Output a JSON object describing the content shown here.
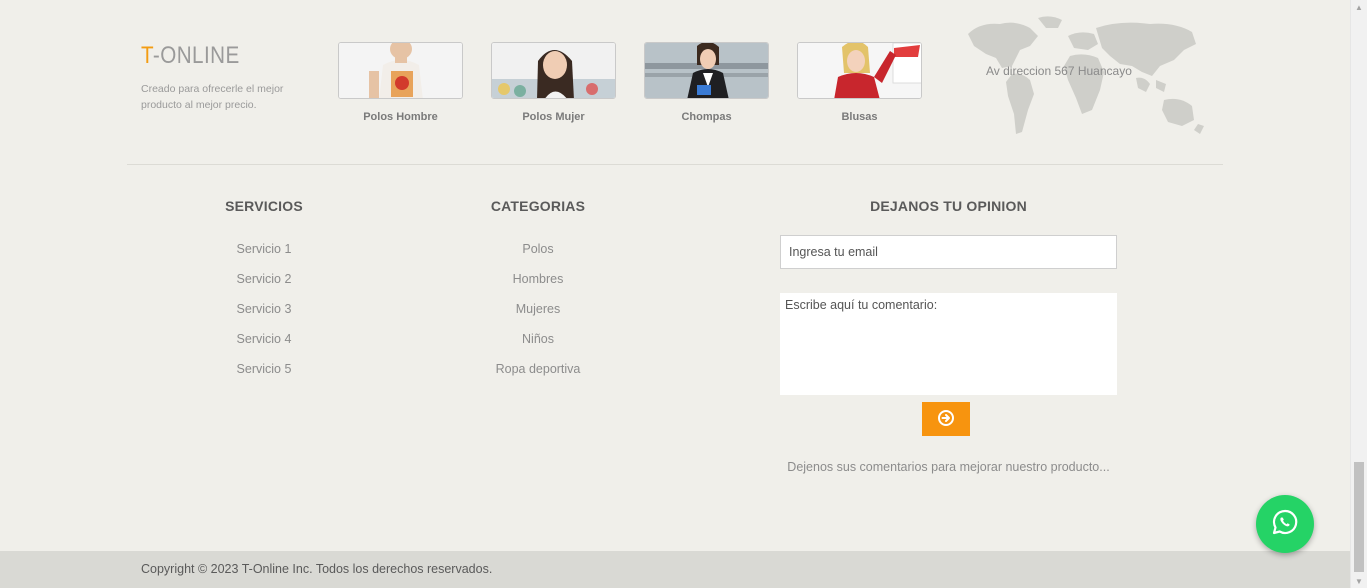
{
  "brand": {
    "title_accent": "T",
    "title_rest": "-ONLINE",
    "description": "Creado para ofrecerle el mejor producto al mejor precio."
  },
  "gallery": [
    {
      "caption": "Polos Hombre"
    },
    {
      "caption": "Polos Mujer"
    },
    {
      "caption": "Chompas"
    },
    {
      "caption": "Blusas"
    }
  ],
  "address": "Av direccion 567 Huancayo",
  "servicios": {
    "title": "SERVICIOS",
    "items": [
      "Servicio 1",
      "Servicio 2",
      "Servicio 3",
      "Servicio 4",
      "Servicio 5"
    ]
  },
  "categorias": {
    "title": "CATEGORIAS",
    "items": [
      "Polos",
      "Hombres",
      "Mujeres",
      "Niños",
      "Ropa deportiva"
    ]
  },
  "opinion": {
    "title": "DEJANOS TU OPINION",
    "email_placeholder": "Ingresa tu email",
    "comment_placeholder": "Escribe aquí tu comentario:",
    "note": "Dejenos sus comentarios para mejorar nuestro producto..."
  },
  "footer": {
    "copyright": "Copyright © 2023 T-Online Inc. Todos los derechos reservados."
  },
  "colors": {
    "accent": "#f39c12",
    "button": "#f7940f",
    "whatsapp": "#25d366",
    "background": "#f0efea"
  }
}
